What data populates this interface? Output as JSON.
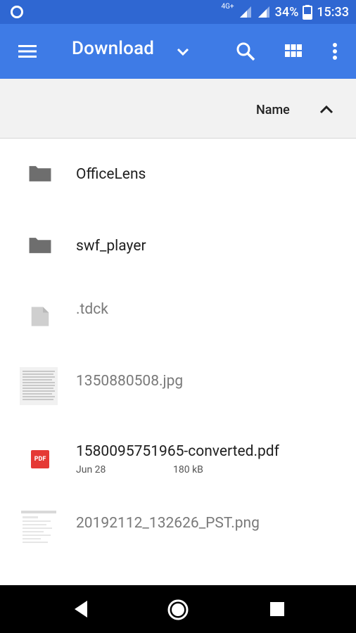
{
  "status": {
    "network": "4G+",
    "battery": "34%",
    "time": "15:33"
  },
  "appbar": {
    "title": "Download",
    "icons": [
      "menu-icon",
      "chevron-down-icon",
      "search-icon",
      "grid-view-icon",
      "more-vert-icon"
    ]
  },
  "sort": {
    "label": "Name",
    "direction": "ascending"
  },
  "files": [
    {
      "name": "OfficeLens",
      "type": "folder"
    },
    {
      "name": "swf_player",
      "type": "folder"
    },
    {
      "name": ".tdck",
      "type": "file"
    },
    {
      "name": "1350880508.jpg",
      "type": "image"
    },
    {
      "name": "1580095751965-converted.pdf",
      "type": "pdf",
      "date": "Jun 28",
      "size": "180 kB",
      "badge": "PDF"
    },
    {
      "name": "20192112_132626_PST.png",
      "type": "image"
    }
  ],
  "colors": {
    "status_bar": "#2f67d2",
    "app_bar": "#3e7be6",
    "sort_bar": "#f2f2f2",
    "pdf_red": "#e53935",
    "folder_gray": "#6e6e6e"
  }
}
